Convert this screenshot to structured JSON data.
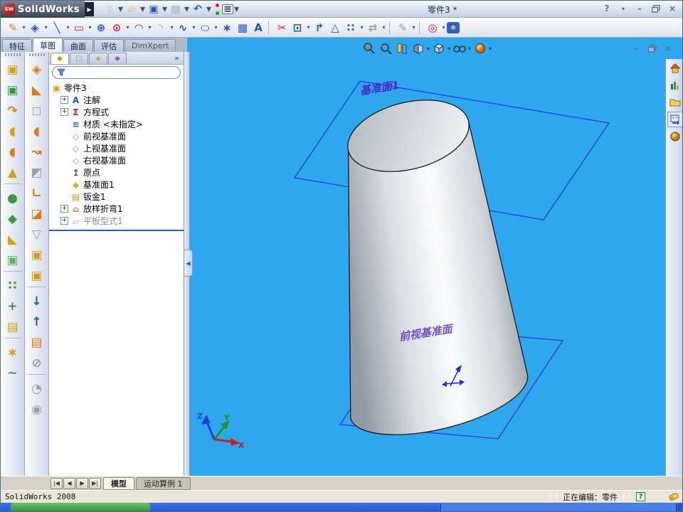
{
  "window": {
    "title": "零件3 *",
    "help": "?",
    "minimize": "–",
    "close": "×"
  },
  "brand": {
    "logo_small": "SW",
    "name": "SolidWorks",
    "menu_arrow": "▶"
  },
  "standard_toolbar": {
    "items": [
      {
        "name": "new-document-button",
        "g": "▯",
        "cls": "ic-page"
      },
      {
        "name": "new-dropdown",
        "g": "▾",
        "cls": "dd"
      },
      {
        "name": "open-button",
        "g": "▱",
        "cls": "ic-folder"
      },
      {
        "name": "open-dropdown",
        "g": "▾",
        "cls": "dd"
      },
      {
        "name": "save-button",
        "g": "▣",
        "cls": "ic-save"
      },
      {
        "name": "save-dropdown",
        "g": "▾",
        "cls": "dd"
      },
      {
        "name": "print-button",
        "g": "▤",
        "cls": "ic-print"
      },
      {
        "name": "print-dropdown",
        "g": "▾",
        "cls": "dd"
      },
      {
        "name": "undo-button",
        "g": "↶",
        "cls": "ic-undo"
      },
      {
        "name": "undo-dropdown",
        "g": "▾",
        "cls": "dd"
      },
      {
        "name": "rebuild-button",
        "g": "",
        "cls": "ic-traffic"
      },
      {
        "name": "options-button",
        "g": "≡",
        "cls": "ic-opts"
      },
      {
        "name": "options-dropdown",
        "g": "▾",
        "cls": "dd"
      }
    ]
  },
  "sketch_toolbar": {
    "items": [
      {
        "name": "sketch-button",
        "g": "✎",
        "cls": "ic-or"
      },
      {
        "name": "sketch-dropdown",
        "g": "▾",
        "cls": "dd"
      },
      {
        "name": "smart-dimension-button",
        "g": "◈",
        "cls": "ic-blue"
      },
      {
        "name": "smart-dimension-dropdown",
        "g": "▾",
        "cls": "dd"
      },
      {
        "name": "line-button",
        "g": "╲",
        "cls": "ic-blue"
      },
      {
        "name": "line-dropdown",
        "g": "▾",
        "cls": "dd"
      },
      {
        "name": "rectangle-button",
        "g": "▭",
        "cls": "ic-red"
      },
      {
        "name": "rectangle-dropdown",
        "g": "▾",
        "cls": "dd"
      },
      {
        "name": "polygon-button",
        "g": "⊕",
        "cls": "ic-blue"
      },
      {
        "name": "circle-button",
        "g": "⊙",
        "cls": "ic-red"
      },
      {
        "name": "circle-dropdown",
        "g": "▾",
        "cls": "dd"
      },
      {
        "name": "centerpoint-arc-button",
        "g": "◠",
        "cls": "ic-red"
      },
      {
        "name": "arc-dropdown",
        "g": "▾",
        "cls": "dd"
      },
      {
        "name": "sketch-fillet-button",
        "g": "◝",
        "cls": "ic-gray"
      },
      {
        "name": "fillet-dropdown",
        "g": "▾",
        "cls": "dd"
      },
      {
        "name": "spline-button",
        "g": "∿",
        "cls": "ic-blue"
      },
      {
        "name": "spline-dropdown",
        "g": "▾",
        "cls": "dd"
      },
      {
        "name": "ellipse-button",
        "g": "○",
        "cls": "ic-blue squash"
      },
      {
        "name": "ellipse-dropdown",
        "g": "▾",
        "cls": "dd"
      },
      {
        "name": "point-button",
        "g": "∗",
        "cls": "ic-blue"
      },
      {
        "name": "area-hatch-button",
        "g": "▦",
        "cls": "ic-blue"
      },
      {
        "name": "text-button",
        "g": "A",
        "cls": "ic-blue"
      },
      {
        "name": "separator",
        "g": "",
        "cls": "sep"
      },
      {
        "name": "trim-entities-button",
        "g": "✂",
        "cls": "ic-red"
      },
      {
        "name": "convert-entities-button",
        "g": "⊡",
        "cls": "ic-blue"
      },
      {
        "name": "convert-dropdown",
        "g": "▾",
        "cls": "dd"
      },
      {
        "name": "offset-entities-button",
        "g": "↱",
        "cls": "ic-blue"
      },
      {
        "name": "mirror-entities-button",
        "g": "△",
        "cls": "ic-blue"
      },
      {
        "name": "linear-sketch-pattern-button",
        "g": "∷",
        "cls": "ic-blue"
      },
      {
        "name": "pattern-dropdown",
        "g": "▾",
        "cls": "dd"
      },
      {
        "name": "move-entities-button",
        "g": "⇄",
        "cls": "ic-gray"
      },
      {
        "name": "move-dropdown",
        "g": "▾",
        "cls": "dd"
      },
      {
        "name": "separator",
        "g": "",
        "cls": "sep"
      },
      {
        "name": "display-relations-button",
        "g": "✎",
        "cls": "ic-gray"
      },
      {
        "name": "relations-dropdown",
        "g": "▾",
        "cls": "dd"
      },
      {
        "name": "separator",
        "g": "",
        "cls": "sep"
      },
      {
        "name": "quick-snaps-button",
        "g": "◎",
        "cls": "ic-red"
      },
      {
        "name": "quick-snaps-dropdown",
        "g": "▾",
        "cls": "dd"
      },
      {
        "name": "rapid-sketch-button",
        "g": "∗",
        "cls": "ic-rapid"
      }
    ]
  },
  "command_tabs": {
    "items": [
      {
        "label": "特征",
        "name": "tab-features"
      },
      {
        "label": "草图",
        "cls": "active",
        "name": "tab-sketch"
      },
      {
        "label": "曲面",
        "name": "tab-surfaces"
      },
      {
        "label": "评估",
        "name": "tab-evaluate"
      },
      {
        "label": "DimXpert",
        "cls": "dim",
        "name": "tab-dimxpert"
      }
    ]
  },
  "left_toolbar1": {
    "items": [
      {
        "name": "extruded-boss-button",
        "g": "▣",
        "cls": "ic-gold"
      },
      {
        "name": "revolved-boss-button",
        "g": "▣",
        "cls": "ic-grn"
      },
      {
        "name": "swept-boss-button",
        "g": "↷",
        "cls": "ic-or"
      },
      {
        "name": "lofted-boss-button",
        "g": "◖",
        "cls": "ic-gold"
      },
      {
        "name": "boundary-boss-button",
        "g": "◖",
        "cls": "ic-or"
      },
      {
        "name": "dome-button",
        "g": "▲",
        "cls": "ic-gold"
      },
      {
        "name": "toolbar-separator",
        "g": "",
        "cls": "lsep"
      },
      {
        "name": "fillet-feature-button",
        "g": "●",
        "cls": "ic-grn"
      },
      {
        "name": "chamfer-button",
        "g": "◆",
        "cls": "ic-grn"
      },
      {
        "name": "rib-button",
        "g": "◣",
        "cls": "ic-gold"
      },
      {
        "name": "shell-button",
        "g": "▣",
        "cls": "ic-grn2"
      },
      {
        "name": "toolbar-separator",
        "g": "",
        "cls": "lsep"
      },
      {
        "name": "linear-pattern-button",
        "g": "∷",
        "cls": "ic-grn"
      },
      {
        "name": "circular-pattern-button",
        "g": "+",
        "cls": "ic-grn"
      },
      {
        "name": "mirror-feature-button",
        "g": "▤",
        "cls": "ic-gold"
      },
      {
        "name": "toolbar-separator",
        "g": "",
        "cls": "lsep"
      },
      {
        "name": "reference-geometry-button",
        "g": "∗",
        "cls": "ic-gold"
      },
      {
        "name": "curves-button",
        "g": "~",
        "cls": "ic-grn"
      }
    ]
  },
  "left_toolbar2": {
    "items": [
      {
        "name": "base-flange-button",
        "g": "◈",
        "cls": "ic-or"
      },
      {
        "name": "edge-flange-button",
        "g": "◣",
        "cls": "ic-or"
      },
      {
        "name": "lofted-bend-button",
        "g": "◻",
        "cls": "ic-gray"
      },
      {
        "name": "hem-button",
        "g": "◖",
        "cls": "ic-or"
      },
      {
        "name": "jog-button",
        "g": "↝",
        "cls": "ic-or"
      },
      {
        "name": "miter-flange-button",
        "g": "◩",
        "cls": "ic-gray"
      },
      {
        "name": "sketched-bend-button",
        "g": "∟",
        "cls": "ic-or"
      },
      {
        "name": "closed-corner-button",
        "g": "◪",
        "cls": "ic-or"
      },
      {
        "name": "break-corner-button",
        "g": "▽",
        "cls": "ic-gray"
      },
      {
        "name": "extruded-cut-button",
        "g": "▣",
        "cls": "ic-gold"
      },
      {
        "name": "simple-hole-button",
        "g": "▣",
        "cls": "ic-gold"
      },
      {
        "name": "toolbar-separator",
        "g": "",
        "cls": "lsep"
      },
      {
        "name": "unfold-button",
        "g": "↓",
        "cls": "ic-blue"
      },
      {
        "name": "fold-button",
        "g": "↑",
        "cls": "ic-blue"
      },
      {
        "name": "flatten-button",
        "g": "▤",
        "cls": "ic-or"
      },
      {
        "name": "no-bends-button",
        "g": "⊘",
        "cls": "ic-gray"
      },
      {
        "name": "toolbar-separator",
        "g": "",
        "cls": "lsep"
      },
      {
        "name": "rip-button",
        "g": "◔",
        "cls": "ic-gray"
      },
      {
        "name": "vent-button",
        "g": "◉",
        "cls": "ic-gray"
      }
    ]
  },
  "panel": {
    "chevron": "»",
    "tabs": {
      "items": [
        {
          "g": "◆",
          "cls": "active ic-fm",
          "name": "featuremanager-tab"
        },
        {
          "g": "□",
          "cls": "ic-pm",
          "name": "propertymanager-tab"
        },
        {
          "g": "◈",
          "cls": "ic-cm",
          "name": "configurationmanager-tab"
        },
        {
          "g": "◆",
          "cls": "ic-dx",
          "name": "dimxpertmanager-tab"
        }
      ]
    },
    "tree": {
      "items": [
        {
          "label": "零件3",
          "g": "▣",
          "cls": "lvl0 ic-part",
          "expand": "",
          "name": "tree-item-part"
        },
        {
          "label": "注解",
          "g": "A",
          "cls": "ic-ann",
          "expand": "+",
          "name": "tree-item-annotations"
        },
        {
          "label": "方程式",
          "g": "Σ",
          "cls": "ic-eq",
          "expand": "+",
          "name": "tree-item-equations"
        },
        {
          "label": "材质 <未指定>",
          "g": "≡",
          "cls": "ic-mat",
          "expand": "",
          "name": "tree-item-material"
        },
        {
          "label": "前视基准面",
          "g": "◇",
          "cls": "ic-plane",
          "expand": "",
          "name": "tree-item-front-plane"
        },
        {
          "label": "上视基准面",
          "g": "◇",
          "cls": "ic-plane",
          "expand": "",
          "name": "tree-item-top-plane"
        },
        {
          "label": "右视基准面",
          "g": "◇",
          "cls": "ic-plane",
          "expand": "",
          "name": "tree-item-right-plane"
        },
        {
          "label": "原点",
          "g": "↥",
          "cls": "ic-origin",
          "expand": "",
          "name": "tree-item-origin"
        },
        {
          "label": "基准面1",
          "g": "◆",
          "cls": "ic-plane1",
          "expand": "",
          "name": "tree-item-plane1"
        },
        {
          "label": "钣金1",
          "g": "▤",
          "cls": "ic-sheet",
          "expand": "",
          "name": "tree-item-sheet-metal1"
        },
        {
          "label": "放样折弯1",
          "g": "⌂",
          "cls": "ic-loft",
          "expand": "+",
          "name": "tree-item-lofted-bend1"
        },
        {
          "label": "平板型式1",
          "g": "▱",
          "cls": "ic-flat gray",
          "expand": "+",
          "name": "tree-item-flat-pattern1"
        }
      ]
    }
  },
  "viewport": {
    "plane1_label": "基准面1",
    "front_plane_label": "前视基准面",
    "triad": {
      "x": "X",
      "y": "Y",
      "z": "Z"
    }
  },
  "headsup_icons": [
    "zoom-to-fit",
    "zoom-to-area",
    "previous-view",
    "section-view",
    "view-orientation",
    "hide-show-items",
    "appearances"
  ],
  "task_pane_icons": [
    "solidworks-resources",
    "design-library",
    "file-explorer",
    "view-palette",
    "appearances"
  ],
  "bottom_bar": {
    "vcr": {
      "items": [
        {
          "g": "|◀",
          "name": "first-button"
        },
        {
          "g": "◀",
          "name": "previous-button"
        },
        {
          "g": "▶",
          "name": "next-button"
        },
        {
          "g": "▶|",
          "name": "last-button"
        }
      ]
    },
    "tabs": {
      "items": [
        {
          "label": "模型",
          "cls": "active",
          "name": "model-tab"
        },
        {
          "label": "运动算例 1",
          "name": "motion-study-tab"
        }
      ]
    }
  },
  "status": {
    "app": "SolidWorks 2008",
    "editing": "正在编辑：零件",
    "help": "?"
  }
}
